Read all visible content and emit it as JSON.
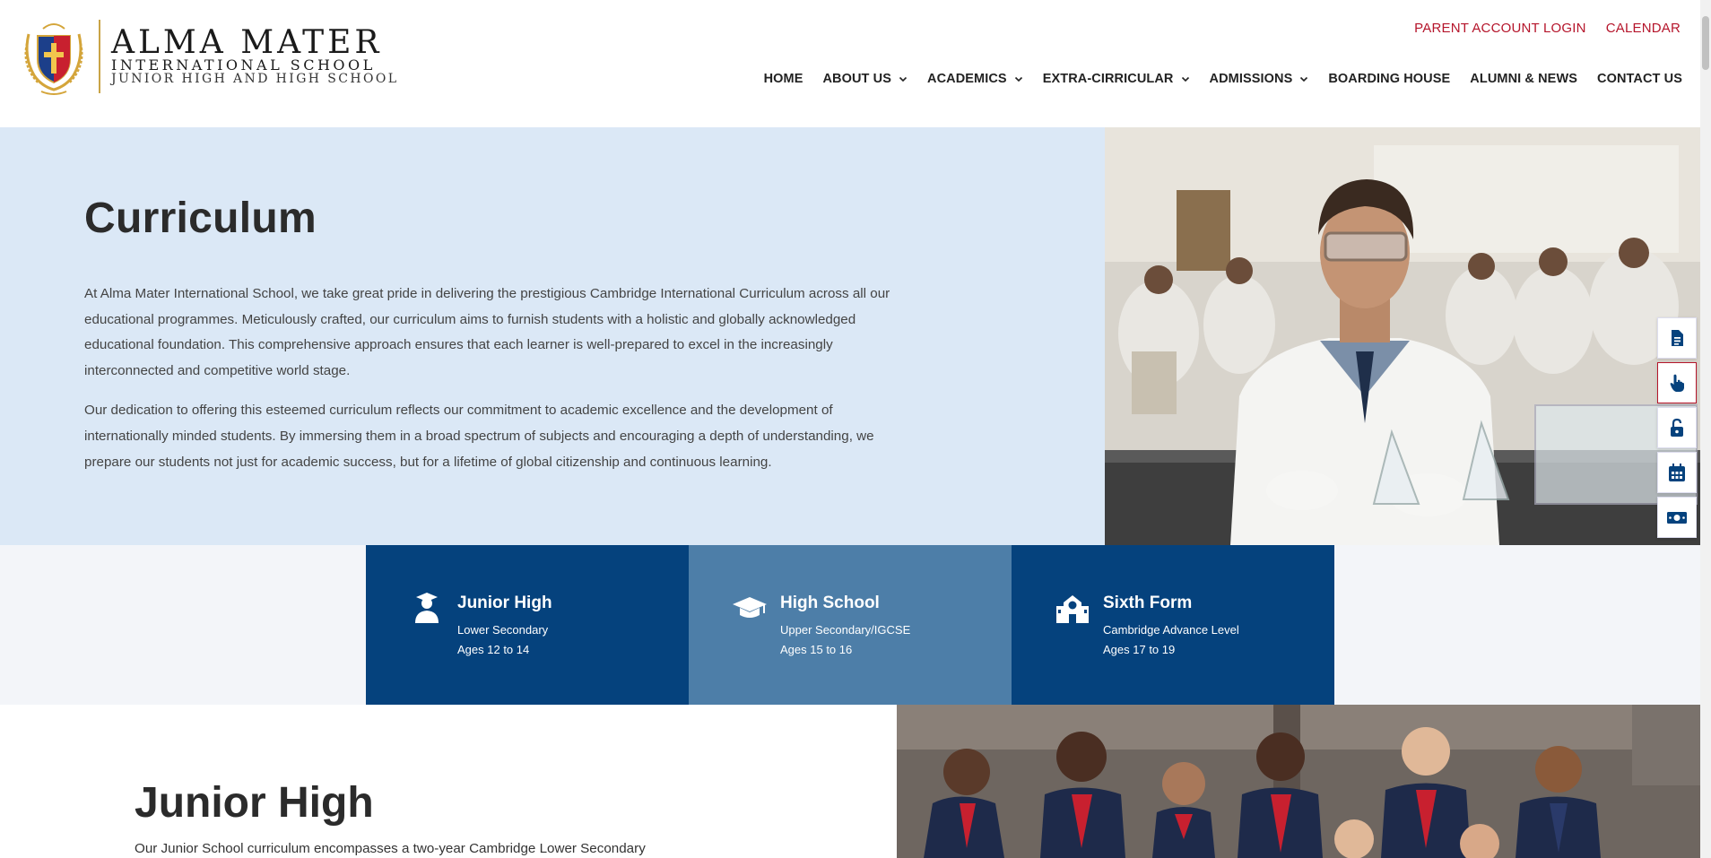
{
  "header": {
    "logo": {
      "name": "ALMA MATER",
      "line2": "INTERNATIONAL SCHOOL",
      "line3": "JUNIOR HIGH AND HIGH SCHOOL"
    },
    "top_links": [
      "PARENT ACCOUNT LOGIN",
      "CALENDAR"
    ],
    "nav": [
      {
        "label": "HOME",
        "dropdown": false
      },
      {
        "label": "ABOUT US",
        "dropdown": true
      },
      {
        "label": "ACADEMICS",
        "dropdown": true
      },
      {
        "label": "EXTRA-CIRRICULAR",
        "dropdown": true
      },
      {
        "label": "ADMISSIONS",
        "dropdown": true
      },
      {
        "label": "BOARDING HOUSE",
        "dropdown": false
      },
      {
        "label": "ALUMNI & NEWS",
        "dropdown": false
      },
      {
        "label": "CONTACT US",
        "dropdown": false
      }
    ]
  },
  "hero": {
    "title": "Curriculum",
    "paragraphs": [
      "At Alma Mater International School, we take great pride in delivering the prestigious Cambridge International Curriculum across all our educational programmes. Meticulously crafted, our curriculum aims to furnish students with a holistic and globally acknowledged educational foundation. This comprehensive approach ensures that each learner is well-prepared to excel in the increasingly interconnected and competitive world stage.",
      "Our dedication to offering this esteemed curriculum reflects our commitment to academic excellence and the development of internationally minded students. By immersing them in a broad spectrum of subjects and encouraging a depth of understanding, we prepare our students not just for academic success, but for a lifetime of global citizenship and continuous learning."
    ]
  },
  "quick_links": [
    {
      "icon": "document-icon"
    },
    {
      "icon": "pointer-hand-icon"
    },
    {
      "icon": "unlock-icon"
    },
    {
      "icon": "calendar-icon"
    },
    {
      "icon": "money-icon"
    }
  ],
  "stages": [
    {
      "title": "Junior High",
      "line1": "Lower Secondary",
      "line2": "Ages 12 to 14",
      "icon": "student-icon"
    },
    {
      "title": "High School",
      "line1": "Upper Secondary/IGCSE",
      "line2": "Ages 15 to 16",
      "icon": "graduation-cap-icon"
    },
    {
      "title": "Sixth Form",
      "line1": "Cambridge Advance Level",
      "line2": "Ages 17 to 19",
      "icon": "school-building-icon"
    }
  ],
  "junior_high": {
    "title": "Junior High",
    "text": "Our Junior School curriculum encompasses a two-year Cambridge Lower Secondary"
  },
  "colors": {
    "brand_dark": "#05427d",
    "brand_mid": "#4d7ea8",
    "accent_red": "#b5152b",
    "hero_bg": "#dbe8f6"
  }
}
